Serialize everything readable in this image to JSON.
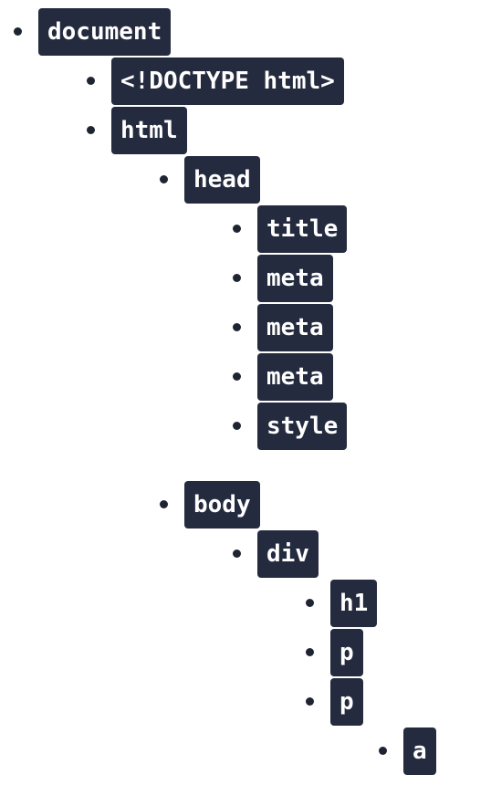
{
  "tree": {
    "document": "document",
    "doctype": "<!DOCTYPE html>",
    "html": "html",
    "head": "head",
    "title": "title",
    "meta_1": "meta",
    "meta_2": "meta",
    "meta_3": "meta",
    "style": "style",
    "body": "body",
    "div": "div",
    "h1": "h1",
    "p_1": "p",
    "p_2": "p",
    "a": "a"
  }
}
